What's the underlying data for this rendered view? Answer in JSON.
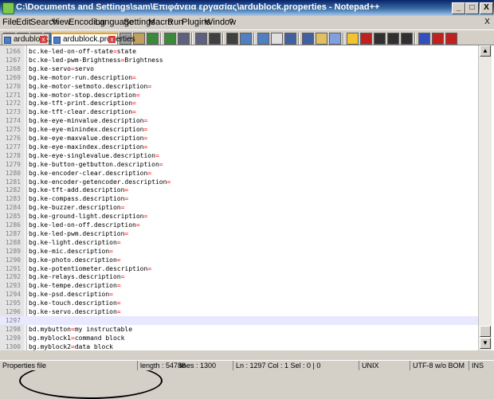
{
  "window": {
    "title": "C:\\Documents and Settings\\sam\\Επιφάνεια εργασίας\\ardublock.properties - Notepad++",
    "minimize_label": "_",
    "maximize_label": "□",
    "close_label": "X"
  },
  "menubar": {
    "items": [
      "File",
      "Edit",
      "Search",
      "View",
      "Encoding",
      "Language",
      "Settings",
      "Macro",
      "Run",
      "Plugins",
      "Window",
      "?"
    ],
    "close_label": "X"
  },
  "toolbar": {
    "buttons": [
      "new-file-icon",
      "open-file-icon",
      "save-icon",
      "save-all-icon",
      "close-icon",
      "close-all-icon",
      "print-icon",
      "cut-icon",
      "copy-icon",
      "paste-icon",
      "undo-icon",
      "redo-icon",
      "find-icon",
      "replace-icon",
      "zoom-in-icon",
      "zoom-out-icon",
      "sync-v-icon",
      "sync-h-icon",
      "word-wrap-icon",
      "show-all-chars-icon",
      "indent-guide-icon",
      "user-lang-icon",
      "doc-map-icon",
      "folder-icon",
      "record-macro-icon",
      "stop-macro-icon",
      "play-macro-icon",
      "run-macro-multiple-icon",
      "save-macro-icon",
      "spell-check-icon",
      "abc-icon"
    ]
  },
  "tabs": [
    {
      "label": "ardublock.xml",
      "active": false
    },
    {
      "label": "ardublock.properties",
      "active": true
    }
  ],
  "editor": {
    "lines": [
      {
        "num": "1266",
        "key": "bc.ke-led-on-off-state",
        "eq": "=",
        "val": "state"
      },
      {
        "num": "1267",
        "key": "bc.ke-led-pwm-Brightness",
        "eq": "=",
        "val": "Brightness"
      },
      {
        "num": "1268",
        "key": "bg.ke-servo",
        "eq": "=",
        "val": "servo"
      },
      {
        "num": "1269",
        "key": "bg.ke-motor-run.description",
        "eq": "=",
        "val": ""
      },
      {
        "num": "1270",
        "key": "bg.ke-motor-setmoto.description",
        "eq": "=",
        "val": ""
      },
      {
        "num": "1271",
        "key": "bg.ke-motor-stop.description",
        "eq": "=",
        "val": ""
      },
      {
        "num": "1272",
        "key": "bg.ke-tft-print.description",
        "eq": "=",
        "val": ""
      },
      {
        "num": "1273",
        "key": "bg.ke-tft-clear.description",
        "eq": "=",
        "val": ""
      },
      {
        "num": "1274",
        "key": "bg.ke-eye-minvalue.description",
        "eq": "=",
        "val": ""
      },
      {
        "num": "1275",
        "key": "bg.ke-eye-minindex.description",
        "eq": "=",
        "val": ""
      },
      {
        "num": "1276",
        "key": "bg.ke-eye-maxvalue.description",
        "eq": "=",
        "val": ""
      },
      {
        "num": "1277",
        "key": "bg.ke-eye-maxindex.description",
        "eq": "=",
        "val": ""
      },
      {
        "num": "1278",
        "key": "bg.ke-eye-singlevalue.description",
        "eq": "=",
        "val": ""
      },
      {
        "num": "1279",
        "key": "bg.ke-button-getbutton.description",
        "eq": "=",
        "val": ""
      },
      {
        "num": "1280",
        "key": "bg.ke-encoder-clear.description",
        "eq": "=",
        "val": ""
      },
      {
        "num": "1281",
        "key": "bg.ke-encoder-getencoder.description",
        "eq": "=",
        "val": ""
      },
      {
        "num": "1282",
        "key": "bg.ke-tft-add.description",
        "eq": "=",
        "val": ""
      },
      {
        "num": "1283",
        "key": "bg.ke-compass.description",
        "eq": "=",
        "val": ""
      },
      {
        "num": "1284",
        "key": "bg.ke-buzzer.description",
        "eq": "=",
        "val": ""
      },
      {
        "num": "1285",
        "key": "bg.ke-ground-light.description",
        "eq": "=",
        "val": ""
      },
      {
        "num": "1286",
        "key": "bg.ke-led-on-off.description",
        "eq": "=",
        "val": ""
      },
      {
        "num": "1287",
        "key": "bg.ke-led-pwm.description",
        "eq": "=",
        "val": ""
      },
      {
        "num": "1288",
        "key": "bg.ke-light.description",
        "eq": "=",
        "val": ""
      },
      {
        "num": "1289",
        "key": "bg.ke-mic.description",
        "eq": "=",
        "val": ""
      },
      {
        "num": "1290",
        "key": "bg.ke-photo.description",
        "eq": "=",
        "val": ""
      },
      {
        "num": "1291",
        "key": "bg.ke-potentiometer.description",
        "eq": "=",
        "val": ""
      },
      {
        "num": "1292",
        "key": "bg.ke-relays.description",
        "eq": "=",
        "val": ""
      },
      {
        "num": "1293",
        "key": "bg.ke-tempe.description",
        "eq": "=",
        "val": ""
      },
      {
        "num": "1294",
        "key": "bg.ke-psd.description",
        "eq": "=",
        "val": ""
      },
      {
        "num": "1295",
        "key": "bg.ke-touch.description",
        "eq": "=",
        "val": ""
      },
      {
        "num": "1296",
        "key": "bg.ke-servo.description",
        "eq": "=",
        "val": ""
      },
      {
        "num": "1297",
        "key": "",
        "eq": "",
        "val": "",
        "current": true
      },
      {
        "num": "1298",
        "key": "bd.mybutton",
        "eq": "=",
        "val": "my instructable"
      },
      {
        "num": "1299",
        "key": "bg.myblock1",
        "eq": "=",
        "val": "command block"
      },
      {
        "num": "1300",
        "key": "bg.myblock2",
        "eq": "=",
        "val": "data block"
      }
    ]
  },
  "statusbar": {
    "file_type": "Properties file",
    "length": "length : 54788",
    "lines": "lines : 1300",
    "position": "Ln : 1297    Col : 1    Sel : 0 | 0",
    "eol": "UNIX",
    "encoding": "UTF-8 w/o BOM",
    "mode": "INS"
  },
  "colors": {
    "key": "#000000",
    "equals": "#ff0000",
    "current_line": "#e8e8ff",
    "title_gradient_start": "#0a246a"
  }
}
